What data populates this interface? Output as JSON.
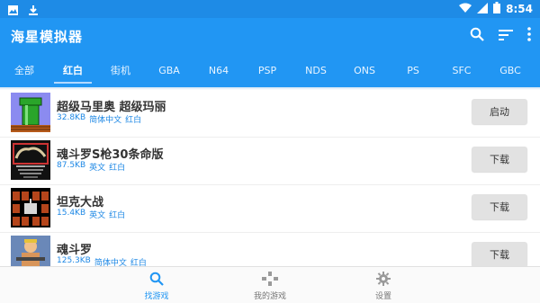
{
  "status_bar": {
    "time": "8:54",
    "icons": [
      "image-icon",
      "download-icon",
      "wifi-icon",
      "signal-icon",
      "battery-icon"
    ]
  },
  "app": {
    "title": "海星模拟器",
    "actions": [
      "search-icon",
      "sort-icon",
      "more-icon"
    ]
  },
  "tabs": [
    {
      "label": "全部"
    },
    {
      "label": "红白",
      "active": true
    },
    {
      "label": "街机"
    },
    {
      "label": "GBA"
    },
    {
      "label": "N64"
    },
    {
      "label": "PSP"
    },
    {
      "label": "NDS"
    },
    {
      "label": "ONS"
    },
    {
      "label": "PS"
    },
    {
      "label": "SFC"
    },
    {
      "label": "GBC"
    }
  ],
  "games": [
    {
      "name": "超级马里奥 超级玛丽",
      "size": "32.8KB",
      "lang": "简体中文",
      "platform": "红白",
      "action": "启动"
    },
    {
      "name": "魂斗罗S枪30条命版",
      "size": "87.5KB",
      "lang": "英文",
      "platform": "红白",
      "action": "下载"
    },
    {
      "name": "坦克大战",
      "size": "15.4KB",
      "lang": "英文",
      "platform": "红白",
      "action": "下载"
    },
    {
      "name": "魂斗罗",
      "size": "125.3KB",
      "lang": "简体中文",
      "platform": "红白",
      "action": "下载"
    }
  ],
  "bottom_nav": [
    {
      "label": "找游戏",
      "icon": "search-icon",
      "active": true
    },
    {
      "label": "我的游戏",
      "icon": "gamepad-icon"
    },
    {
      "label": "设置",
      "icon": "gear-icon"
    }
  ],
  "colors": {
    "primary": "#2196f3",
    "status_bar": "#1e8be6",
    "meta_text": "#1e88e5",
    "button_bg": "#e2e2e2"
  }
}
